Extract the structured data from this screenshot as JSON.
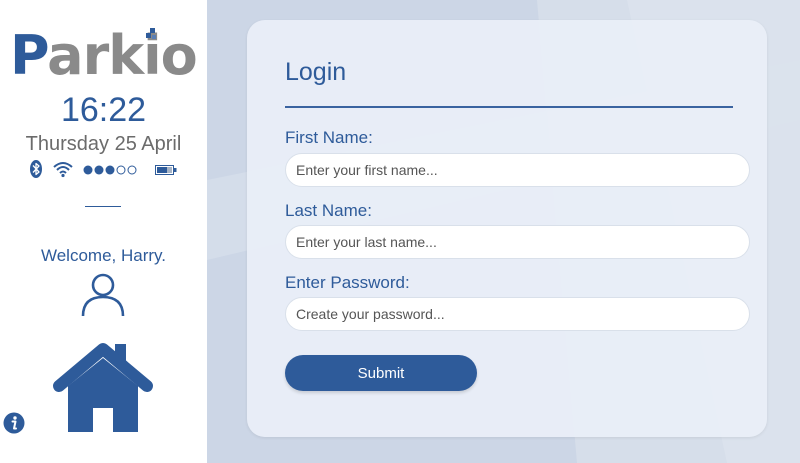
{
  "sidebar": {
    "logo": {
      "first": "P",
      "rest": "arkio"
    },
    "time": "16:22",
    "date": "Thursday 25 April",
    "status": {
      "icons": [
        "bluetooth-icon",
        "wifi-icon",
        "signal-dots-icon",
        "battery-icon"
      ],
      "signal_filled": 3,
      "signal_total": 5
    },
    "welcome_prefix": "Welcome, ",
    "user_name": "Harry",
    "welcome_suffix": "."
  },
  "form": {
    "title": "Login",
    "first_name_label": "First Name:",
    "first_name_placeholder": "Enter your first name...",
    "last_name_label": "Last Name:",
    "last_name_placeholder": "Enter your last name...",
    "password_label": "Enter Password:",
    "password_placeholder": "Create your password...",
    "submit_label": "Submit"
  },
  "colors": {
    "brand": "#2e5b9a",
    "logo_gray": "#8a8a8a",
    "main_bg": "#ccd6e6",
    "card_bg": "#e9eff7"
  }
}
